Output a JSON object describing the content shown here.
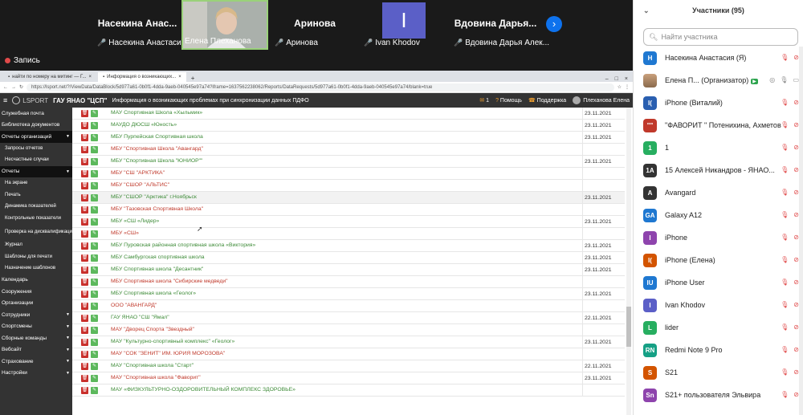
{
  "video": {
    "tiles": [
      {
        "big": "Насекина  Анас...",
        "caption": "Насекина Анастасия",
        "muted": true,
        "type": "name"
      },
      {
        "big": "",
        "caption": "Елена Плеханова",
        "muted": false,
        "type": "video"
      },
      {
        "big": "Аринова",
        "caption": "Аринова",
        "muted": true,
        "type": "name"
      },
      {
        "big": "I",
        "caption": "Ivan Khodov",
        "muted": true,
        "type": "avatar"
      },
      {
        "big": "Вдовина  Дарья...",
        "caption": "Вдовина Дарья Алек...",
        "muted": true,
        "type": "name"
      }
    ],
    "record_label": "Запись"
  },
  "browser": {
    "tab1": "найти по номеру на митинг — Г...",
    "tab2": "Информация о возникающих...",
    "url": "https://lsport.net/?/ViewData/DataBlock/5d977a61-0b0f1-4dda-9aeb-040545e97a74?iframe=1637562238062/Reports/DataRequests/5d977a61-0b0f1-4dda-9aeb-040545e97a74/blank=true",
    "app_logo": "LSPORT",
    "org": "ГАУ ЯНАО \"ЦСП\"",
    "page_title": "Информация о возникающих проблемах при синхронизации данных ПДФО",
    "messages_count": "1",
    "help": "Помощь",
    "support": "Поддержка",
    "user": "Плеханова Елена"
  },
  "sidebar": [
    {
      "label": "Служебная почта",
      "level": 0,
      "arrow": false,
      "active": false
    },
    {
      "label": "Библиотека документов",
      "level": 0,
      "arrow": false,
      "active": false
    },
    {
      "label": "Отчеты организаций",
      "level": 0,
      "arrow": true,
      "active": true
    },
    {
      "label": "Запросы отчетов",
      "level": 1,
      "arrow": false,
      "active": false
    },
    {
      "label": "Несчастные случаи",
      "level": 1,
      "arrow": false,
      "active": false
    },
    {
      "label": "Отчеты",
      "level": 0,
      "arrow": true,
      "active": true
    },
    {
      "label": "На экране",
      "level": 1,
      "arrow": false,
      "active": false
    },
    {
      "label": "Печать",
      "level": 1,
      "arrow": false,
      "active": false
    },
    {
      "label": "Динамика показателей",
      "level": 1,
      "arrow": false,
      "active": false
    },
    {
      "label": "Контрольные показатели",
      "level": 1,
      "arrow": false,
      "active": false
    },
    {
      "label": "Проверка на дисквалификацию",
      "level": 1,
      "arrow": false,
      "active": false
    },
    {
      "label": "Журнал",
      "level": 1,
      "arrow": false,
      "active": false
    },
    {
      "label": "Шаблоны для печати",
      "level": 1,
      "arrow": false,
      "active": false
    },
    {
      "label": "Назначение шаблонов",
      "level": 1,
      "arrow": false,
      "active": false
    },
    {
      "label": "Календарь",
      "level": 0,
      "arrow": false,
      "active": false
    },
    {
      "label": "Сооружения",
      "level": 0,
      "arrow": false,
      "active": false
    },
    {
      "label": "Организации",
      "level": 0,
      "arrow": false,
      "active": false
    },
    {
      "label": "Сотрудники",
      "level": 0,
      "arrow": true,
      "active": false
    },
    {
      "label": "Спортсмены",
      "level": 0,
      "arrow": true,
      "active": false
    },
    {
      "label": "Сборные команды",
      "level": 0,
      "arrow": true,
      "active": false
    },
    {
      "label": "Вебсайт",
      "level": 0,
      "arrow": true,
      "active": false
    },
    {
      "label": "Страхование",
      "level": 0,
      "arrow": true,
      "active": false
    },
    {
      "label": "Настройки",
      "level": 0,
      "arrow": true,
      "active": false
    }
  ],
  "rows": [
    {
      "org": "МАУ Спортивная Школа «Хыльмик»",
      "date": "23.11.2021",
      "color": "#3d8b37"
    },
    {
      "org": "МАУДО ДЮСШ «Юность»",
      "date": "23.11.2021",
      "color": "#3d8b37"
    },
    {
      "org": "МБУ Пурпейская Спортивная школа",
      "date": "23.11.2021",
      "color": "#3d8b37"
    },
    {
      "org": "МБУ \"Спортивная Школа \"Авангард\"",
      "date": "",
      "color": "#c0392b"
    },
    {
      "org": "МБУ \"Спортивная Школа \"ЮНИОР\"\"",
      "date": "23.11.2021",
      "color": "#3d8b37"
    },
    {
      "org": "МБУ \"СШ \"АРКТИКА\"",
      "date": "",
      "color": "#c0392b"
    },
    {
      "org": "МБУ \"СШОР \"АЛЬТИС\"",
      "date": "",
      "color": "#c0392b"
    },
    {
      "org": "МБУ \"СШОР \"Арктика\" г.Ноябрьск",
      "date": "23.11.2021",
      "color": "#3d8b37",
      "hl": true
    },
    {
      "org": "МБУ \"Тазовская Спортивная Школа\"",
      "date": "",
      "color": "#c0392b"
    },
    {
      "org": "МБУ «СШ «Лидер»",
      "date": "23.11.2021",
      "color": "#3d8b37"
    },
    {
      "org": "МБУ «СШ»",
      "date": "",
      "color": "#c0392b"
    },
    {
      "org": "МБУ Пуровская районная спортивная школа «Виктория»",
      "date": "23.11.2021",
      "color": "#3d8b37"
    },
    {
      "org": "МБУ Самбургская спортивная школа",
      "date": "23.11.2021",
      "color": "#3d8b37"
    },
    {
      "org": "МБУ Спортивная школа \"Десантник\"",
      "date": "23.11.2021",
      "color": "#3d8b37"
    },
    {
      "org": "МБУ Спортивная школа \"Сибирские медведи\"",
      "date": "",
      "color": "#c0392b"
    },
    {
      "org": "МБУ Спортивная школа «Геолог»",
      "date": "23.11.2021",
      "color": "#3d8b37"
    },
    {
      "org": "ООО \"АВАНГАРД\"",
      "date": "",
      "color": "#c0392b"
    },
    {
      "org": "ГАУ ЯНАО \"СШ \"Ямал\"",
      "date": "22.11.2021",
      "color": "#3d8b37"
    },
    {
      "org": "МАУ \"Дворец Спорта \"Звездный\"",
      "date": "",
      "color": "#c0392b"
    },
    {
      "org": "МАУ \"Культурно-спортивный комплекс\" «Геолог»",
      "date": "23.11.2021",
      "color": "#3d8b37"
    },
    {
      "org": "МАУ \"СОК \"ЗЕНИТ\" ИМ. ЮРИЯ МОРОЗОВА\"",
      "date": "",
      "color": "#c0392b"
    },
    {
      "org": "МАУ \"Спортивная школа \"Старт\"",
      "date": "22.11.2021",
      "color": "#3d8b37"
    },
    {
      "org": "МАУ \"Спортивная школа \"Фаворит\"",
      "date": "23.11.2021",
      "color": "#c0392b"
    },
    {
      "org": "МАУ «ФИЗКУЛЬТУРНО-ОЗДОРОВИТЕЛЬНЫЙ КОМПЛЕКС ЗДОРОВЬЕ»",
      "date": "",
      "color": "#3d8b37"
    }
  ],
  "participants_panel": {
    "title": "Участники (95)",
    "search_placeholder": "Найти участника",
    "list": [
      {
        "av": "Н",
        "color": "#1f78d1",
        "name": "Насекина Анастасия (Я)",
        "host": false
      },
      {
        "av": "",
        "color": "#b08060",
        "name": "Елена П... (Организатор)",
        "host": true
      },
      {
        "av": "I(",
        "color": "#2a5fb0",
        "name": "iPhone (Виталий)",
        "host": false
      },
      {
        "av": "\"\"",
        "color": "#c0392b",
        "name": "\"ФАВОРИТ \" Потенихина, Ахметов, ...",
        "host": false
      },
      {
        "av": "1",
        "color": "#27ae60",
        "name": "1",
        "host": false
      },
      {
        "av": "1А",
        "color": "#333333",
        "name": "15 Алексей Никандров - ЯНАО...",
        "host": false
      },
      {
        "av": "A",
        "color": "#333333",
        "name": "Avangard",
        "host": false
      },
      {
        "av": "GA",
        "color": "#1f78d1",
        "name": "Galaxy A12",
        "host": false
      },
      {
        "av": "I",
        "color": "#8e44ad",
        "name": "iPhone",
        "host": false
      },
      {
        "av": "I(",
        "color": "#d35400",
        "name": "iPhone (Елена)",
        "host": false
      },
      {
        "av": "IU",
        "color": "#1f78d1",
        "name": "iPhone User",
        "host": false
      },
      {
        "av": "I",
        "color": "#5b5fc7",
        "name": "Ivan Khodov",
        "host": false
      },
      {
        "av": "L",
        "color": "#27ae60",
        "name": "lider",
        "host": false
      },
      {
        "av": "RN",
        "color": "#16a085",
        "name": "Redmi Note 9 Pro",
        "host": false
      },
      {
        "av": "S",
        "color": "#d35400",
        "name": "S21",
        "host": false
      },
      {
        "av": "Sn",
        "color": "#8e44ad",
        "name": "S21+ пользователя Эльвира",
        "host": false
      }
    ]
  }
}
